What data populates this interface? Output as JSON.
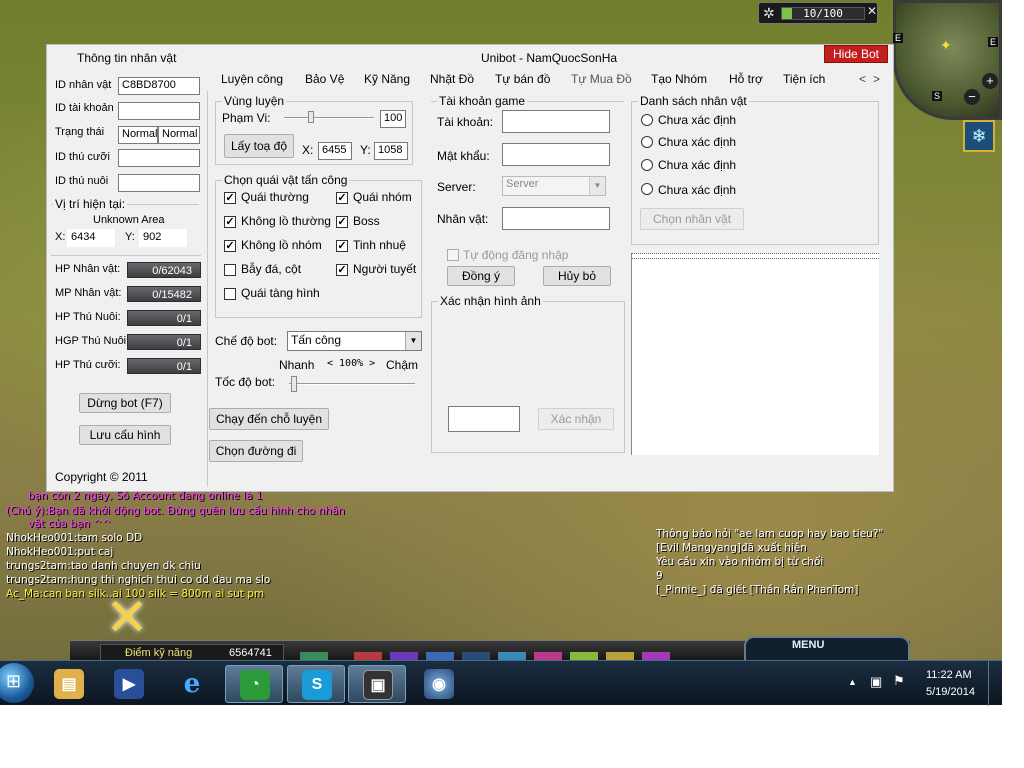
{
  "game": {
    "hud_counter": "10/100",
    "skill_points_label": "Điểm kỹ năng",
    "skill_points_value": "6564741",
    "menu_label": "MENU",
    "minimap_markers": [
      "E",
      "S",
      "E"
    ],
    "chat_left": [
      {
        "text": "bạn còn 2 ngày, Số Account đang online là 1",
        "color": "#ff33ff"
      },
      {
        "text": "(Chú ý):Bạn đã khởi động bot. Đừng quên lưu cấu hình cho nhân",
        "color": "#ff33ff"
      },
      {
        "text": "vật của bạn ^^",
        "color": "#ff33ff"
      },
      {
        "text": "NhokHeo001:tam solo DD",
        "color": "#ffffff"
      },
      {
        "text": "NhokHeo001:put caj",
        "color": "#ffffff"
      },
      {
        "text": "trungs2tam:tao danh chuyen dk chiu",
        "color": "#ffffff"
      },
      {
        "text": "trungs2tam:hung thi nghich thui co dd dau ma slo",
        "color": "#ffffff"
      },
      {
        "text": "Ac_Ma:can ban silk..ai 100 silk = 800m ai sut pm",
        "color": "#ffee44"
      }
    ],
    "chat_right": [
      "Thông báo hỏi \"ae lam cuop hay bao tieu?\"",
      "[Evil Mangyang]đã xuất hiện",
      "Yêu cầu xin vào nhóm bị từ chối",
      "9",
      "[_Pinnie_] đã giết [Thần Rắn PhanTom]"
    ]
  },
  "bot": {
    "title": "Unibot - NamQuocSonHa",
    "hide_button": "Hide Bot",
    "copyright": "Copyright © 2011",
    "tabs": [
      "Luyện công",
      "Bảo Vệ",
      "Kỹ Năng",
      "Nhặt Đồ",
      "Tự bán đồ",
      "Tự Mua Đồ",
      "Tạo Nhóm",
      "Hỗ trợ",
      "Tiện ích"
    ],
    "tab_prev": "<",
    "tab_next": ">",
    "char_info": {
      "title": "Thông tin nhân vật",
      "id_char_label": "ID nhân vật",
      "id_char_value": "C8BD8700",
      "id_account_label": "ID tài khoản",
      "id_account_value": "",
      "status_label": "Trạng thái",
      "status_1": "Normal",
      "status_2": "Normal",
      "mount_label": "ID thú cưỡi",
      "mount_value": "",
      "pet_label": "ID thú nuôi",
      "pet_value": "",
      "position_label": "Vị trí hiện tại:",
      "area": "Unknown Area",
      "x_label": "X:",
      "x_value": "6434",
      "y_label": "Y:",
      "y_value": "902",
      "bars": [
        {
          "label": "HP Nhân vật:",
          "value": "0/62043"
        },
        {
          "label": "MP Nhân vật:",
          "value": "0/15482"
        },
        {
          "label": "HP Thú Nuôi:",
          "value": "0/1"
        },
        {
          "label": "HGP Thú Nuôi:",
          "value": "0/1"
        },
        {
          "label": "HP Thú cưỡi:",
          "value": "0/1"
        }
      ],
      "stop_button": "Dừng bot (F7)",
      "save_button": "Lưu cấu hình"
    },
    "training": {
      "zone_title": "Vùng luyện",
      "range_label": "Phạm Vi:",
      "range_value": "100",
      "get_coords": "Lấy toạ độ",
      "x_label": "X:",
      "x_value": "6455",
      "y_label": "Y:",
      "y_value": "1058",
      "monster_title": "Chọn quái vật tấn công",
      "monsters": [
        {
          "label": "Quái thường",
          "checked": true
        },
        {
          "label": "Quái nhóm",
          "checked": true
        },
        {
          "label": "Không lồ thường",
          "checked": true
        },
        {
          "label": "Boss",
          "checked": true
        },
        {
          "label": "Không lồ nhóm",
          "checked": true
        },
        {
          "label": "Tinh nhuệ",
          "checked": true
        },
        {
          "label": "Bẫy đá, cột",
          "checked": false
        },
        {
          "label": "Người tuyết",
          "checked": true
        },
        {
          "label": "Quái tàng hình",
          "checked": false
        }
      ],
      "mode_label": "Chế độ bot:",
      "mode_value": "Tấn công",
      "speed_fast": "Nhanh",
      "speed_mid": "< 100% >",
      "speed_slow": "Chậm",
      "speed_label": "Tốc độ bot:",
      "run_button": "Chạy đến chỗ luyện",
      "path_button": "Chọn đường đi"
    },
    "account": {
      "title": "Tài khoản game",
      "user_label": "Tài khoản:",
      "pass_label": "Mật khẩu:",
      "server_label": "Server:",
      "server_value": "Server",
      "char_label": "Nhân vật:",
      "auto_login": "Tự động đăng nhập",
      "ok_button": "Đồng ý",
      "cancel_button": "Hủy bỏ",
      "captcha_title": "Xác nhận hình ảnh",
      "confirm_button": "Xác nhận"
    },
    "char_list": {
      "title": "Danh sách nhân vật",
      "items": [
        "Chưa xác định",
        "Chưa xác định",
        "Chưa xác định",
        "Chưa xác định"
      ],
      "select_button": "Chọn nhân vật"
    }
  },
  "taskbar": {
    "time": "11:22 AM",
    "date": "5/19/2014"
  }
}
